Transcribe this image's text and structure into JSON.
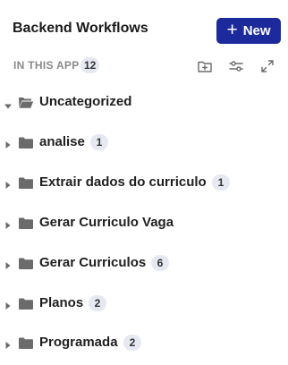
{
  "header": {
    "title": "Backend Workflows",
    "new_button": {
      "plus": "+",
      "label": "New"
    }
  },
  "subheader": {
    "label": "IN THIS APP",
    "count": "12",
    "tools": [
      "add-folder-icon",
      "filter-sliders-icon",
      "expand-icon"
    ]
  },
  "folders": [
    {
      "name": "Uncategorized",
      "count": "",
      "expanded": true
    },
    {
      "name": "analise",
      "count": "1",
      "expanded": false
    },
    {
      "name": "Extrair dados do curriculo",
      "count": "1",
      "expanded": false
    },
    {
      "name": "Gerar Curriculo Vaga",
      "count": "",
      "expanded": false
    },
    {
      "name": "Gerar Curriculos",
      "count": "6",
      "expanded": false
    },
    {
      "name": "Planos",
      "count": "2",
      "expanded": false
    },
    {
      "name": "Programada",
      "count": "2",
      "expanded": false
    }
  ],
  "colors": {
    "accent": "#1d2a9c",
    "badge_bg": "#e6e9f1",
    "icon": "#6b6b6b"
  }
}
